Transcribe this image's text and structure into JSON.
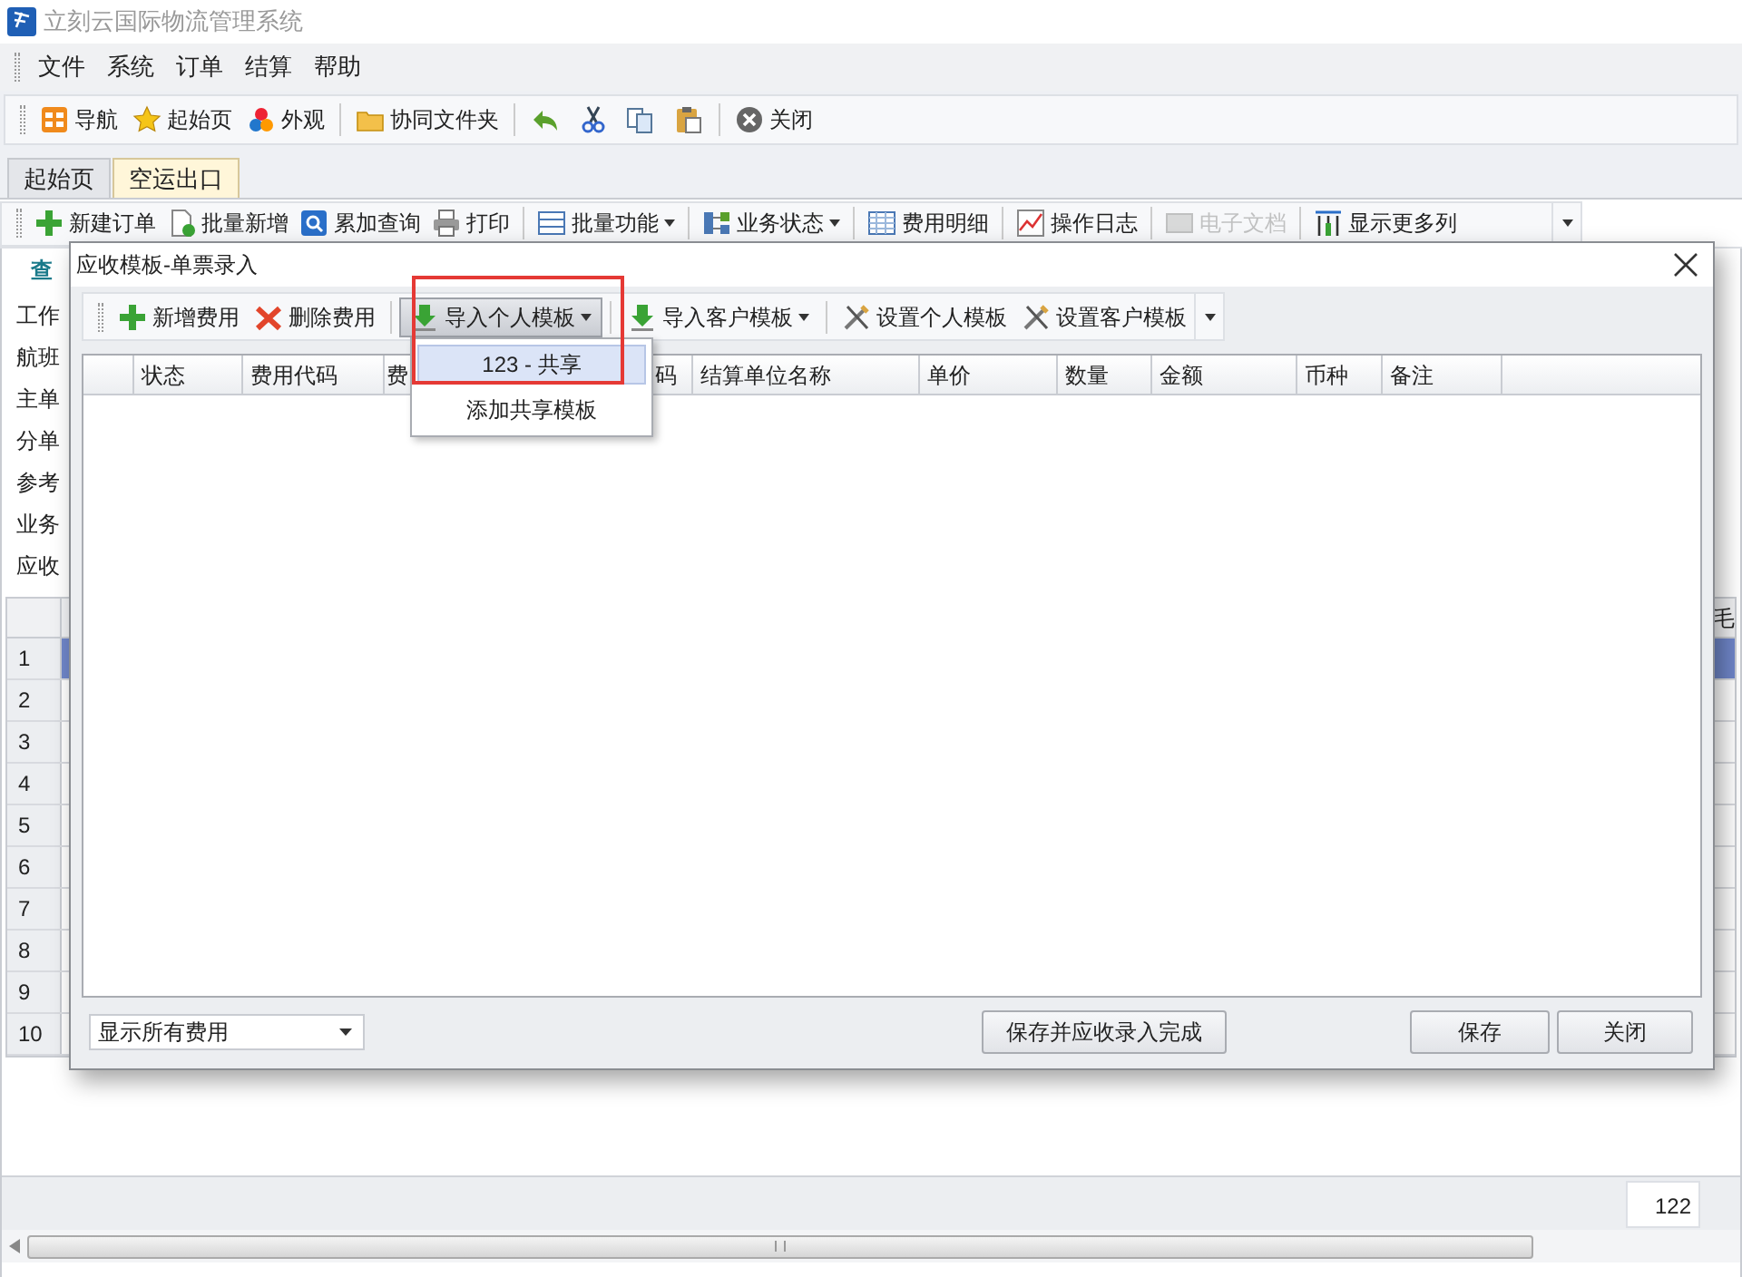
{
  "app_title": "立刻云国际物流管理系统",
  "menu": [
    "文件",
    "系统",
    "订单",
    "结算",
    "帮助"
  ],
  "toolbar": [
    {
      "kind": "button",
      "label": "导航"
    },
    {
      "kind": "button",
      "label": "起始页"
    },
    {
      "kind": "button",
      "label": "外观"
    },
    {
      "kind": "separator"
    },
    {
      "kind": "button",
      "label": "协同文件夹"
    },
    {
      "kind": "separator"
    },
    {
      "kind": "icon_button"
    },
    {
      "kind": "icon_button"
    },
    {
      "kind": "icon_button"
    },
    {
      "kind": "icon_button"
    },
    {
      "kind": "separator"
    },
    {
      "kind": "button",
      "label": "关闭"
    }
  ],
  "tabs": [
    {
      "label": "起始页",
      "selected": false
    },
    {
      "label": "空运出口",
      "selected": true
    }
  ],
  "order_toolbar": [
    {
      "kind": "button",
      "label": "新建订单",
      "disabled": false
    },
    {
      "kind": "button",
      "label": "批量新增",
      "disabled": false
    },
    {
      "kind": "button",
      "label": "累加查询",
      "disabled": false
    },
    {
      "kind": "button",
      "label": "打印",
      "disabled": false
    },
    {
      "kind": "separator"
    },
    {
      "kind": "dropdown",
      "label": "批量功能",
      "disabled": false
    },
    {
      "kind": "separator"
    },
    {
      "kind": "dropdown",
      "label": "业务状态",
      "disabled": false
    },
    {
      "kind": "separator"
    },
    {
      "kind": "button",
      "label": "费用明细",
      "disabled": false
    },
    {
      "kind": "separator"
    },
    {
      "kind": "button",
      "label": "操作日志",
      "disabled": false
    },
    {
      "kind": "separator"
    },
    {
      "kind": "button",
      "label": "电子文档",
      "disabled": true
    },
    {
      "kind": "separator"
    },
    {
      "kind": "button",
      "label": "显示更多列",
      "disabled": false
    }
  ],
  "query_link": "查",
  "form_labels": [
    "工作",
    "航班",
    "主单",
    "分单",
    "参考",
    "业务",
    "应收"
  ],
  "grid": {
    "column_label": "毛",
    "rows": [
      {
        "number": "1",
        "selected": true
      },
      {
        "number": "2",
        "selected": false
      },
      {
        "number": "3",
        "selected": false
      },
      {
        "number": "4",
        "selected": false
      },
      {
        "number": "5",
        "selected": false
      },
      {
        "number": "6",
        "selected": false
      },
      {
        "number": "7",
        "selected": false
      },
      {
        "number": "8",
        "selected": false
      },
      {
        "number": "9",
        "selected": false
      },
      {
        "number": "10",
        "selected": false
      }
    ]
  },
  "footer_field": "122",
  "dialog": {
    "title": "应收模板-单票录入",
    "toolbar": [
      {
        "kind": "button",
        "label": "新增费用"
      },
      {
        "kind": "button",
        "label": "删除费用"
      },
      {
        "kind": "separator"
      },
      {
        "kind": "dropdown",
        "label": "导入个人模板",
        "expanded": true
      },
      {
        "kind": "separator"
      },
      {
        "kind": "dropdown",
        "label": "导入客户模板",
        "expanded": false
      },
      {
        "kind": "separator"
      },
      {
        "kind": "button",
        "label": "设置个人模板"
      },
      {
        "kind": "button",
        "label": "设置客户模板"
      }
    ],
    "columns": [
      "",
      "状态",
      "费用代码",
      "费",
      "码",
      "结算单位名称",
      "单价",
      "数量",
      "金额",
      "币种",
      "备注"
    ],
    "dropdown_menu": [
      {
        "label": "123 - 共享",
        "selected": true
      },
      {
        "label": "添加共享模板",
        "selected": false
      }
    ],
    "filter_select": "显示所有费用",
    "buttons": [
      "保存并应收录入完成",
      "保存",
      "关闭"
    ]
  }
}
